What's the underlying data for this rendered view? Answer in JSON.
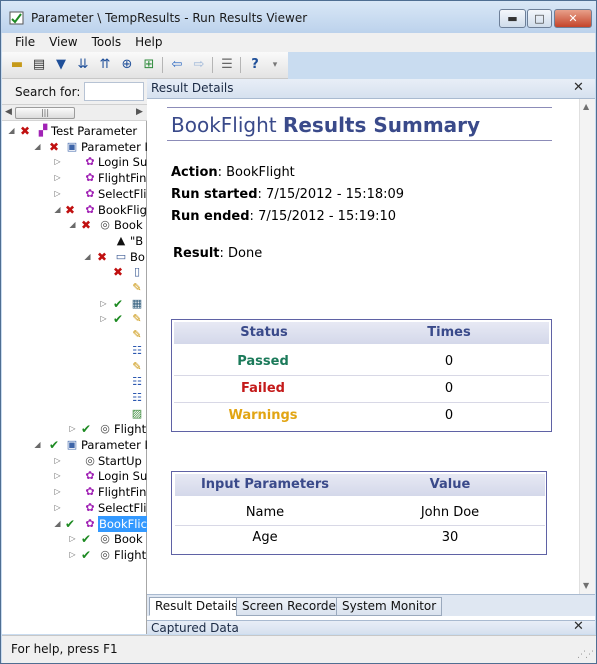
{
  "window": {
    "title": "Parameter \\ TempResults - Run Results Viewer",
    "controls": {
      "minimize": "▬",
      "maximize": "□",
      "close": "✕"
    }
  },
  "menubar": [
    "File",
    "View",
    "Tools",
    "Help"
  ],
  "toolbar": {
    "icons": [
      "open-icon",
      "print-icon",
      "filter-icon",
      "expand-all-icon",
      "collapse-all-icon",
      "jump-to-step-icon",
      "add-icon",
      "back-arrow-icon",
      "forward-arrow-icon",
      "list-icon",
      "help-icon",
      "toolbar-options-icon"
    ]
  },
  "search": {
    "label": "Search for:",
    "value": ""
  },
  "tree": [
    {
      "label": "Test Parameter",
      "status": "fail",
      "icon": "test-icon"
    },
    {
      "label": "Parameter I",
      "status": "fail",
      "icon": "iteration-icon"
    },
    {
      "label": "Login Su",
      "status": "",
      "icon": "action-icon"
    },
    {
      "label": "FlightFin",
      "status": "",
      "icon": "action-icon"
    },
    {
      "label": "SelectFlic",
      "status": "",
      "icon": "action-icon"
    },
    {
      "label": "BookFlig",
      "status": "fail",
      "icon": "action-icon"
    },
    {
      "label": "Book",
      "status": "fail",
      "icon": "browser-icon"
    },
    {
      "label": "\"B",
      "status": "",
      "icon": "checkpoint-icon"
    },
    {
      "label": "Bo",
      "status": "fail",
      "icon": "page-icon"
    },
    {
      "label": "",
      "status": "fail",
      "icon": "document-icon"
    },
    {
      "label": "",
      "status": "",
      "icon": "pencil-icon"
    },
    {
      "label": "",
      "status": "pass",
      "icon": "table-icon"
    },
    {
      "label": "",
      "status": "pass",
      "icon": "pencil-icon"
    },
    {
      "label": "",
      "status": "",
      "icon": "pencil-icon"
    },
    {
      "label": "",
      "status": "",
      "icon": "list-icon"
    },
    {
      "label": "",
      "status": "",
      "icon": "pencil-icon"
    },
    {
      "label": "",
      "status": "",
      "icon": "list-icon"
    },
    {
      "label": "",
      "status": "",
      "icon": "list-icon"
    },
    {
      "label": "",
      "status": "",
      "icon": "image-icon"
    },
    {
      "label": "Flight",
      "status": "pass",
      "icon": "browser-icon"
    },
    {
      "label": "Parameter I",
      "status": "pass",
      "icon": "iteration-icon"
    },
    {
      "label": "StartUp",
      "status": "",
      "icon": "browser-icon"
    },
    {
      "label": "Login Su",
      "status": "",
      "icon": "action-icon"
    },
    {
      "label": "FlightFin",
      "status": "",
      "icon": "action-icon"
    },
    {
      "label": "SelectFlic",
      "status": "",
      "icon": "action-icon"
    },
    {
      "label": "BookFlic",
      "status": "pass",
      "icon": "action-icon",
      "selected": true
    },
    {
      "label": "Book",
      "status": "pass",
      "icon": "browser-icon"
    },
    {
      "label": "Flight",
      "status": "pass",
      "icon": "browser-icon"
    }
  ],
  "result_details": {
    "panel_title": "Result Details",
    "summary_title_part1": "BookFlight",
    "summary_title_part2": "Results Summary",
    "action_label": "Action",
    "action_value": "BookFlight",
    "run_started_label": "Run started",
    "run_started_value": "7/15/2012 - 15:18:09",
    "run_ended_label": "Run ended",
    "run_ended_value": "7/15/2012 - 15:19:10",
    "result_label": "Result",
    "result_value": "Done",
    "status_table": {
      "headers": [
        "Status",
        "Times"
      ],
      "rows": [
        {
          "status": "Passed",
          "times": "0"
        },
        {
          "status": "Failed",
          "times": "0"
        },
        {
          "status": "Warnings",
          "times": "0"
        }
      ]
    },
    "params_table": {
      "headers": [
        "Input Parameters",
        "Value"
      ],
      "rows": [
        {
          "name": "Name",
          "value": "John Doe"
        },
        {
          "name": "Age",
          "value": "30"
        }
      ]
    }
  },
  "bottom_tabs": [
    "Result Details",
    "Screen Recorder",
    "System Monitor"
  ],
  "captured_data": {
    "title": "Captured Data"
  },
  "statusbar": {
    "text": "For help, press F1"
  }
}
